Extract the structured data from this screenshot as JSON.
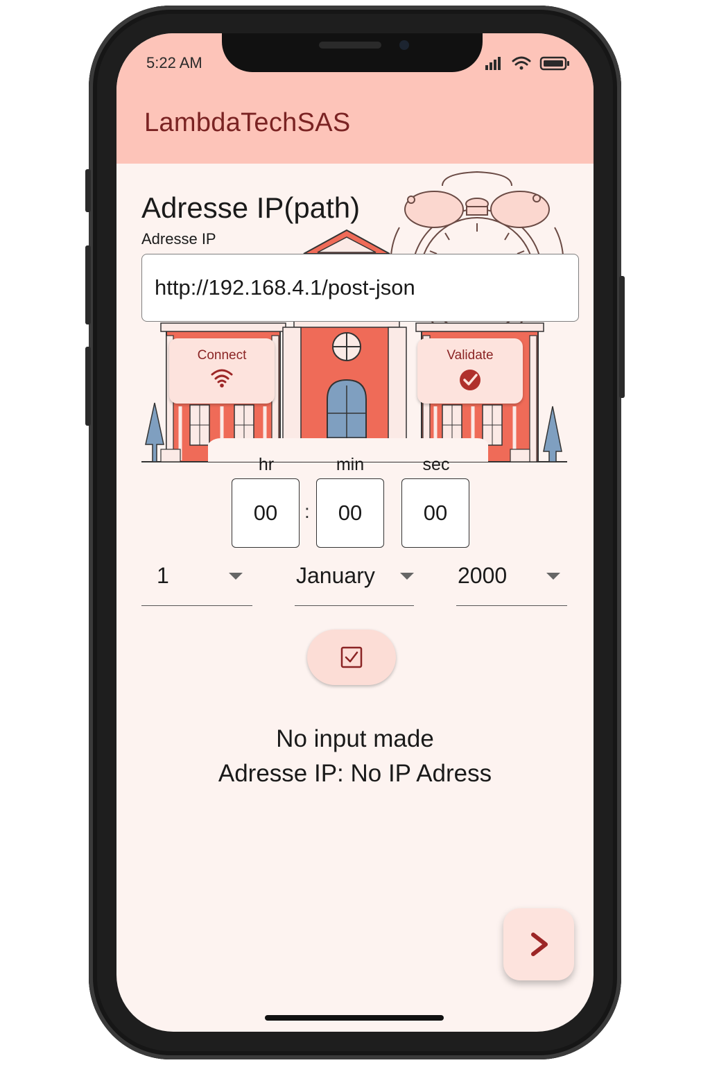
{
  "status_bar": {
    "time": "5:22 AM"
  },
  "app_bar": {
    "title": "LambdaTechSAS"
  },
  "ip_section": {
    "title": "Adresse IP(path)",
    "field_label": "Adresse IP",
    "field_value": "http://192.168.4.1/post-json"
  },
  "actions": {
    "connect_label": "Connect",
    "validate_label": "Validate"
  },
  "time_picker": {
    "hr_label": "hr",
    "min_label": "min",
    "sec_label": "sec",
    "hr": "00",
    "min": "00",
    "sec": "00",
    "separator": ":"
  },
  "date_picker": {
    "day": "1",
    "month": "January",
    "year": "2000"
  },
  "result": {
    "line1": "No input made",
    "line2": "Adresse IP: No IP Adress"
  },
  "colors": {
    "app_bar": "#fdc4b9",
    "background": "#fdf3f0",
    "accent": "#8a2424",
    "building": "#ef6b58"
  },
  "icons": {
    "connect": "wifi-icon",
    "validate": "check-badge-icon",
    "confirm": "checkbox-icon",
    "next": "chevron-right-icon"
  }
}
